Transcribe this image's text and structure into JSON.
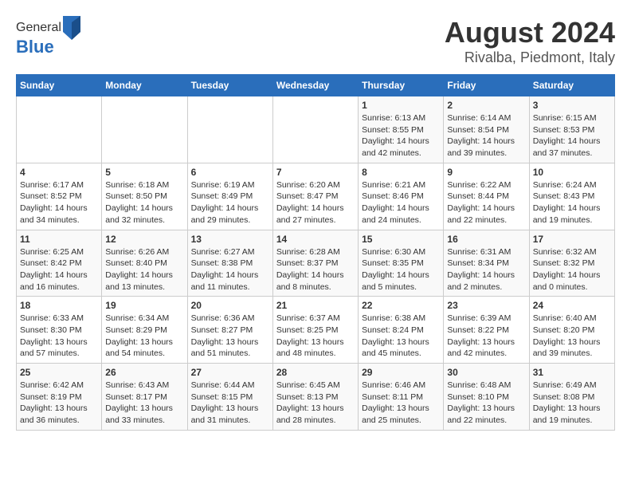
{
  "header": {
    "logo_general": "General",
    "logo_blue": "Blue",
    "title": "August 2024",
    "subtitle": "Rivalba, Piedmont, Italy"
  },
  "weekdays": [
    "Sunday",
    "Monday",
    "Tuesday",
    "Wednesday",
    "Thursday",
    "Friday",
    "Saturday"
  ],
  "weeks": [
    [
      {
        "day": "",
        "info": ""
      },
      {
        "day": "",
        "info": ""
      },
      {
        "day": "",
        "info": ""
      },
      {
        "day": "",
        "info": ""
      },
      {
        "day": "1",
        "info": "Sunrise: 6:13 AM\nSunset: 8:55 PM\nDaylight: 14 hours\nand 42 minutes."
      },
      {
        "day": "2",
        "info": "Sunrise: 6:14 AM\nSunset: 8:54 PM\nDaylight: 14 hours\nand 39 minutes."
      },
      {
        "day": "3",
        "info": "Sunrise: 6:15 AM\nSunset: 8:53 PM\nDaylight: 14 hours\nand 37 minutes."
      }
    ],
    [
      {
        "day": "4",
        "info": "Sunrise: 6:17 AM\nSunset: 8:52 PM\nDaylight: 14 hours\nand 34 minutes."
      },
      {
        "day": "5",
        "info": "Sunrise: 6:18 AM\nSunset: 8:50 PM\nDaylight: 14 hours\nand 32 minutes."
      },
      {
        "day": "6",
        "info": "Sunrise: 6:19 AM\nSunset: 8:49 PM\nDaylight: 14 hours\nand 29 minutes."
      },
      {
        "day": "7",
        "info": "Sunrise: 6:20 AM\nSunset: 8:47 PM\nDaylight: 14 hours\nand 27 minutes."
      },
      {
        "day": "8",
        "info": "Sunrise: 6:21 AM\nSunset: 8:46 PM\nDaylight: 14 hours\nand 24 minutes."
      },
      {
        "day": "9",
        "info": "Sunrise: 6:22 AM\nSunset: 8:44 PM\nDaylight: 14 hours\nand 22 minutes."
      },
      {
        "day": "10",
        "info": "Sunrise: 6:24 AM\nSunset: 8:43 PM\nDaylight: 14 hours\nand 19 minutes."
      }
    ],
    [
      {
        "day": "11",
        "info": "Sunrise: 6:25 AM\nSunset: 8:42 PM\nDaylight: 14 hours\nand 16 minutes."
      },
      {
        "day": "12",
        "info": "Sunrise: 6:26 AM\nSunset: 8:40 PM\nDaylight: 14 hours\nand 13 minutes."
      },
      {
        "day": "13",
        "info": "Sunrise: 6:27 AM\nSunset: 8:38 PM\nDaylight: 14 hours\nand 11 minutes."
      },
      {
        "day": "14",
        "info": "Sunrise: 6:28 AM\nSunset: 8:37 PM\nDaylight: 14 hours\nand 8 minutes."
      },
      {
        "day": "15",
        "info": "Sunrise: 6:30 AM\nSunset: 8:35 PM\nDaylight: 14 hours\nand 5 minutes."
      },
      {
        "day": "16",
        "info": "Sunrise: 6:31 AM\nSunset: 8:34 PM\nDaylight: 14 hours\nand 2 minutes."
      },
      {
        "day": "17",
        "info": "Sunrise: 6:32 AM\nSunset: 8:32 PM\nDaylight: 14 hours\nand 0 minutes."
      }
    ],
    [
      {
        "day": "18",
        "info": "Sunrise: 6:33 AM\nSunset: 8:30 PM\nDaylight: 13 hours\nand 57 minutes."
      },
      {
        "day": "19",
        "info": "Sunrise: 6:34 AM\nSunset: 8:29 PM\nDaylight: 13 hours\nand 54 minutes."
      },
      {
        "day": "20",
        "info": "Sunrise: 6:36 AM\nSunset: 8:27 PM\nDaylight: 13 hours\nand 51 minutes."
      },
      {
        "day": "21",
        "info": "Sunrise: 6:37 AM\nSunset: 8:25 PM\nDaylight: 13 hours\nand 48 minutes."
      },
      {
        "day": "22",
        "info": "Sunrise: 6:38 AM\nSunset: 8:24 PM\nDaylight: 13 hours\nand 45 minutes."
      },
      {
        "day": "23",
        "info": "Sunrise: 6:39 AM\nSunset: 8:22 PM\nDaylight: 13 hours\nand 42 minutes."
      },
      {
        "day": "24",
        "info": "Sunrise: 6:40 AM\nSunset: 8:20 PM\nDaylight: 13 hours\nand 39 minutes."
      }
    ],
    [
      {
        "day": "25",
        "info": "Sunrise: 6:42 AM\nSunset: 8:19 PM\nDaylight: 13 hours\nand 36 minutes."
      },
      {
        "day": "26",
        "info": "Sunrise: 6:43 AM\nSunset: 8:17 PM\nDaylight: 13 hours\nand 33 minutes."
      },
      {
        "day": "27",
        "info": "Sunrise: 6:44 AM\nSunset: 8:15 PM\nDaylight: 13 hours\nand 31 minutes."
      },
      {
        "day": "28",
        "info": "Sunrise: 6:45 AM\nSunset: 8:13 PM\nDaylight: 13 hours\nand 28 minutes."
      },
      {
        "day": "29",
        "info": "Sunrise: 6:46 AM\nSunset: 8:11 PM\nDaylight: 13 hours\nand 25 minutes."
      },
      {
        "day": "30",
        "info": "Sunrise: 6:48 AM\nSunset: 8:10 PM\nDaylight: 13 hours\nand 22 minutes."
      },
      {
        "day": "31",
        "info": "Sunrise: 6:49 AM\nSunset: 8:08 PM\nDaylight: 13 hours\nand 19 minutes."
      }
    ]
  ]
}
